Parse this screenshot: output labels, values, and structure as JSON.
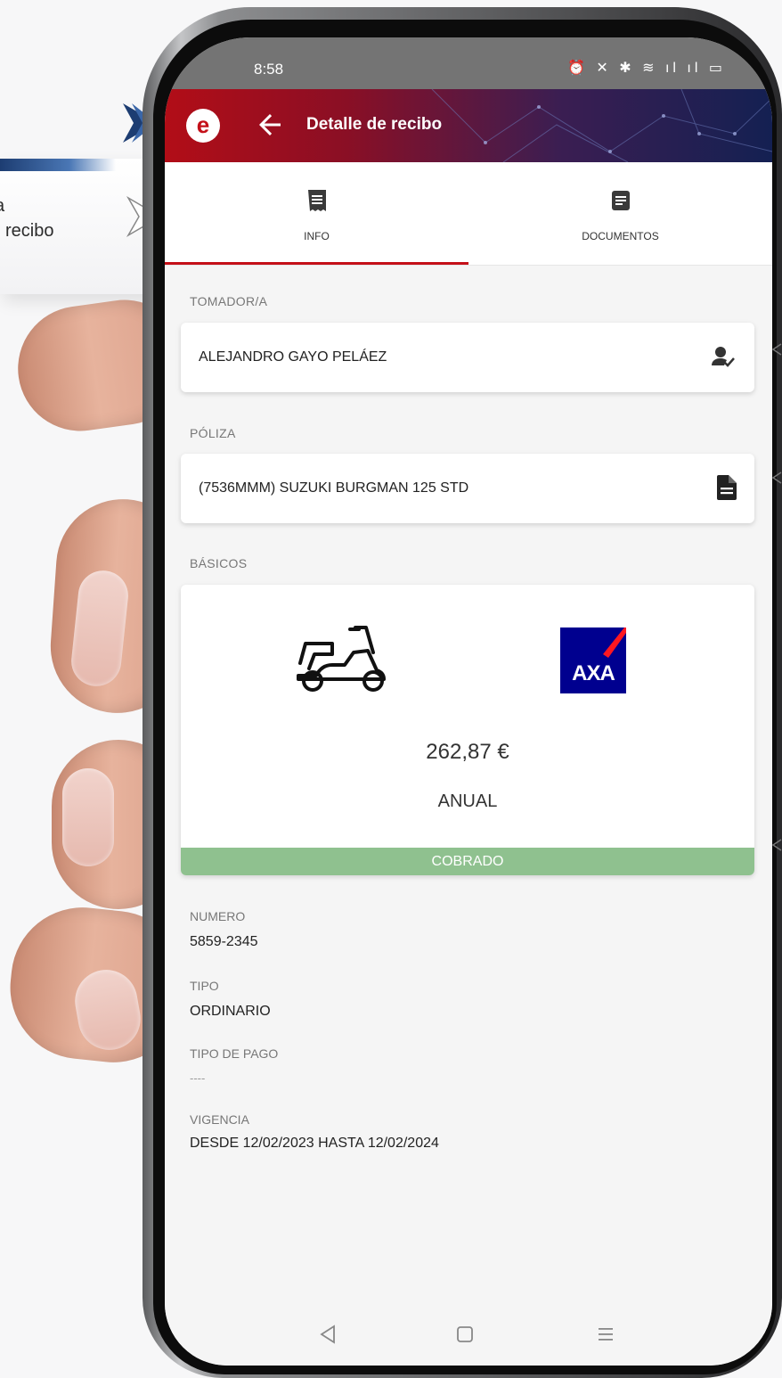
{
  "annotation": {
    "line1": "a",
    "line2": "l recibo"
  },
  "status_bar": {
    "time": "8:58",
    "icons": "⏰ ✕ ✱ ≋ ıl ıl ▭"
  },
  "app_bar": {
    "logo_letter": "e",
    "title": "Detalle de recibo"
  },
  "tabs": [
    {
      "label": "INFO",
      "active": true
    },
    {
      "label": "DOCUMENTOS",
      "active": false
    }
  ],
  "tomador": {
    "section_label": "TOMADOR/A",
    "name": "ALEJANDRO GAYO PELÁEZ"
  },
  "poliza": {
    "section_label": "PÓLIZA",
    "description": "(7536MMM) SUZUKI BURGMAN 125 STD"
  },
  "basicos": {
    "section_label": "BÁSICOS",
    "vehicle_icon": "scooter-icon",
    "insurer_logo_text": "AXA",
    "price": "262,87 €",
    "period": "ANUAL",
    "status": "COBRADO",
    "status_color": "#8fc18f"
  },
  "details": {
    "numero_label": "NUMERO",
    "numero_value": "5859-2345",
    "tipo_label": "TIPO",
    "tipo_value": "ORDINARIO",
    "tipo_pago_label": "TIPO DE PAGO",
    "tipo_pago_value": "----",
    "vigencia_label": "VIGENCIA",
    "vigencia_value": "DESDE 12/02/2023 HASTA 12/02/2024"
  },
  "colors": {
    "brand_red": "#c41019",
    "appbar_dark": "#142052"
  }
}
